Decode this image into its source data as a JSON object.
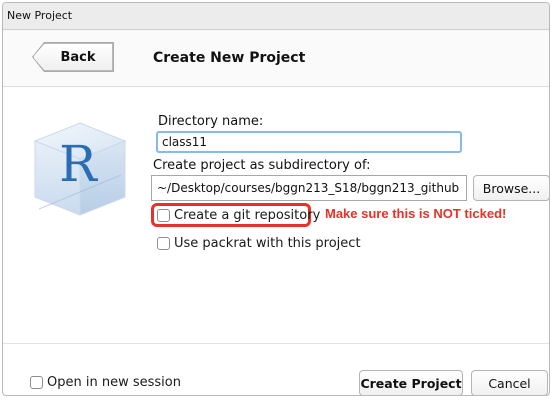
{
  "window": {
    "title": "New Project"
  },
  "header": {
    "back_label": "Back",
    "title": "Create New Project"
  },
  "form": {
    "directory_name_label": "Directory name:",
    "directory_name_value": "class11",
    "subdirectory_label": "Create project as subdirectory of:",
    "subdirectory_value": "~/Desktop/courses/bggn213_S18/bggn213_github",
    "browse_label": "Browse...",
    "git_checkbox_label": "Create a git repository",
    "git_checked": false,
    "packrat_checkbox_label": "Use packrat with this project",
    "packrat_checked": false
  },
  "annotation": {
    "text": "Make sure this is NOT ticked!",
    "color": "#e8312a"
  },
  "footer": {
    "new_session_label": "Open in new session",
    "new_session_checked": false,
    "create_label": "Create Project",
    "cancel_label": "Cancel"
  },
  "icons": {
    "logo": "r-logo-icon",
    "back": "back-arrow-button"
  },
  "colors": {
    "focus_border": "#88b8f0",
    "highlight": "#e8312a",
    "logo_blue": "#2a6db4"
  }
}
